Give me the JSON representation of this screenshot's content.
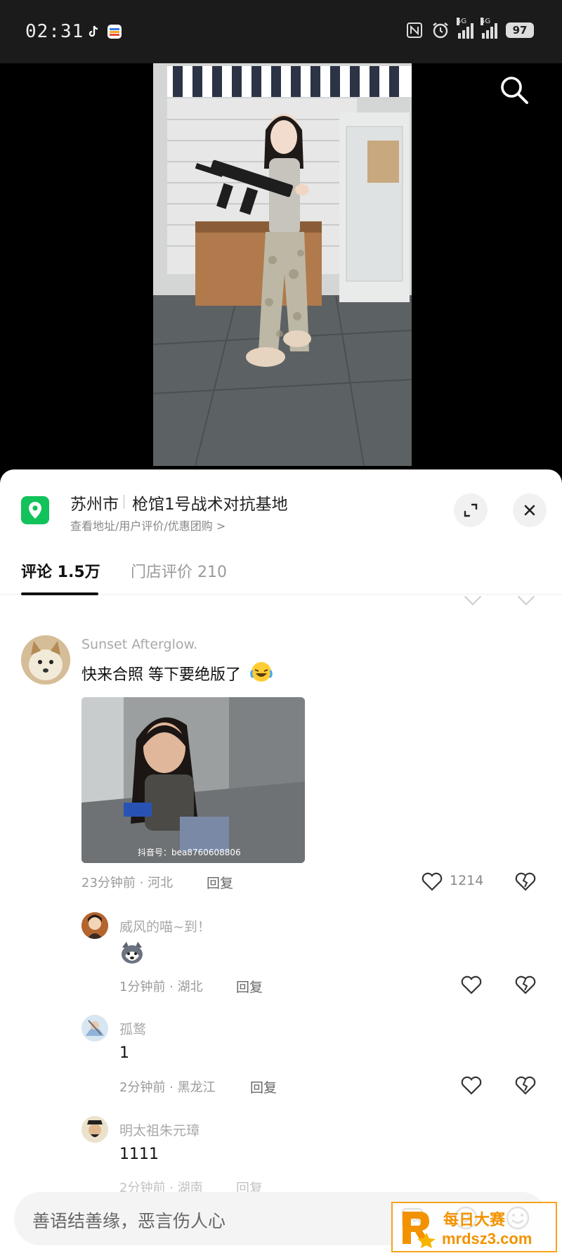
{
  "status_bar": {
    "time": "02:31",
    "signal_1_label": "5G",
    "signal_2_label": "5G",
    "battery": "97"
  },
  "location": {
    "city": "苏州市",
    "name": "枪馆1号战术对抗基地",
    "sub": "查看地址/用户评价/优惠团购 >"
  },
  "tabs": [
    {
      "label": "评论 1.5万",
      "active": true
    },
    {
      "label": "门店评价 210",
      "active": false
    }
  ],
  "comment_main": {
    "user": "Sunset Afterglow.",
    "text": "快来合照 等下要绝版了",
    "image_caption": "抖音号：bea8760608806",
    "time_loc": "23分钟前 · 河北",
    "reply": "回复",
    "likes": "1214"
  },
  "replies": [
    {
      "user": "威风的喵~到！",
      "text": "",
      "time_loc": "1分钟前 · 湖北",
      "reply": "回复"
    },
    {
      "user": "孤鹜",
      "text": "1",
      "time_loc": "2分钟前 · 黑龙江",
      "reply": "回复"
    },
    {
      "user": "明太祖朱元璋",
      "text": "1111",
      "time_loc": "2分钟前 · 湖南",
      "reply": "回复"
    }
  ],
  "input": {
    "placeholder": "善语结善缘，恶言伤人心"
  },
  "watermark": {
    "cn": "每日大赛",
    "url": "mrdsz3.com"
  },
  "colors": {
    "location_pin": "#12c25b",
    "watermark": "#f39200"
  }
}
